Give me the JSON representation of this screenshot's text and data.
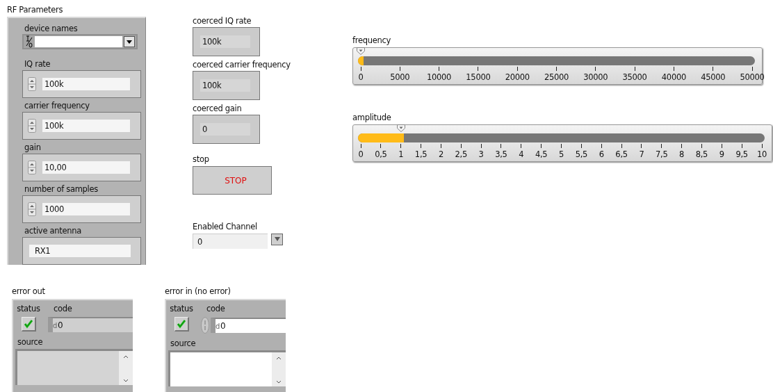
{
  "rf_parameters": {
    "title": "RF Parameters",
    "device_names": {
      "label": "device names"
    },
    "numerics": [
      {
        "label": "IQ rate",
        "value": "100k"
      },
      {
        "label": "carrier frequency",
        "value": "100k"
      },
      {
        "label": "gain",
        "value": "10,00"
      },
      {
        "label": "number of samples",
        "value": "1000"
      }
    ],
    "active_antenna": {
      "label": "active antenna",
      "value": "RX1"
    }
  },
  "indicators": [
    {
      "label": "coerced IQ rate",
      "value": "100k"
    },
    {
      "label": "coerced carrier frequency",
      "value": "100k"
    },
    {
      "label": "coerced gain",
      "value": "0"
    }
  ],
  "stop": {
    "label": "stop",
    "button": "STOP"
  },
  "enabled_channel": {
    "label": "Enabled Channel",
    "value": "0"
  },
  "sliders": [
    {
      "label": "frequency",
      "level": 0.0,
      "ticks": [
        "0",
        "5000",
        "10000",
        "15000",
        "20000",
        "25000",
        "30000",
        "35000",
        "40000",
        "45000",
        "50000"
      ]
    },
    {
      "label": "amplitude",
      "level": 0.1,
      "ticks": [
        "0",
        "0,5",
        "1",
        "1,5",
        "2",
        "2,5",
        "3",
        "3,5",
        "4",
        "4,5",
        "5",
        "5,5",
        "6",
        "6,5",
        "7",
        "7,5",
        "8",
        "8,5",
        "9",
        "9,5",
        "10"
      ]
    }
  ],
  "error_clusters": [
    {
      "label": "error out",
      "kind": "indicator",
      "status_label": "status",
      "checked": true,
      "code_label": "code",
      "radix": "d",
      "code": "0",
      "source_label": "source"
    },
    {
      "label": "error in (no error)",
      "kind": "control",
      "status_label": "status",
      "checked": true,
      "code_label": "code",
      "radix": "d",
      "code": "0",
      "source_label": "source"
    }
  ]
}
